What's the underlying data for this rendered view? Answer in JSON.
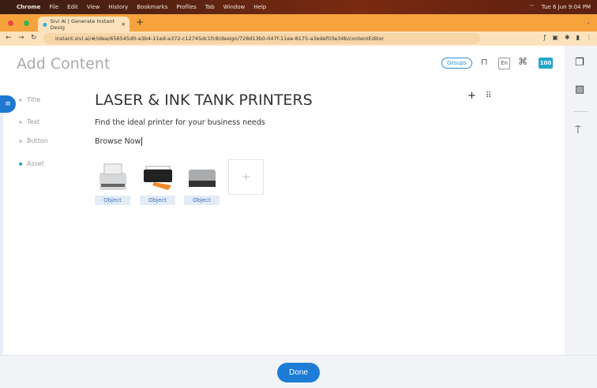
{
  "menubar": {
    "app": "Chrome",
    "items": [
      "File",
      "Edit",
      "View",
      "History",
      "Bookmarks",
      "Profiles",
      "Tab",
      "Window",
      "Help"
    ],
    "datetime": "Tue 6 Jun  9:04 PM"
  },
  "browser": {
    "tab_title": "Sivi AI | Generate Instant Desig",
    "url": "instant.sivi.ai/#/idea/656545d0-a3b4-11ed-a372-c12745dc1fc8/design/728d13b0-047f-11ee-8175-a3edef03e34b/contentEditor"
  },
  "header": {
    "title": "Add Content",
    "groups_label": "Groups",
    "lang": "En",
    "score": "100"
  },
  "fields": [
    {
      "label": "Title"
    },
    {
      "label": "Text"
    },
    {
      "label": "Button"
    },
    {
      "label": "Asset"
    }
  ],
  "content": {
    "title": "LASER & INK TANK PRINTERS",
    "text": "Find the ideal printer for your business needs",
    "button": "Browse Now",
    "assets": [
      {
        "label": "Object"
      },
      {
        "label": "Object"
      },
      {
        "label": "Object"
      }
    ]
  },
  "footer": {
    "done_label": "Done"
  },
  "colors": {
    "accent": "#1c7cd6",
    "badge": "#22a7c9"
  }
}
